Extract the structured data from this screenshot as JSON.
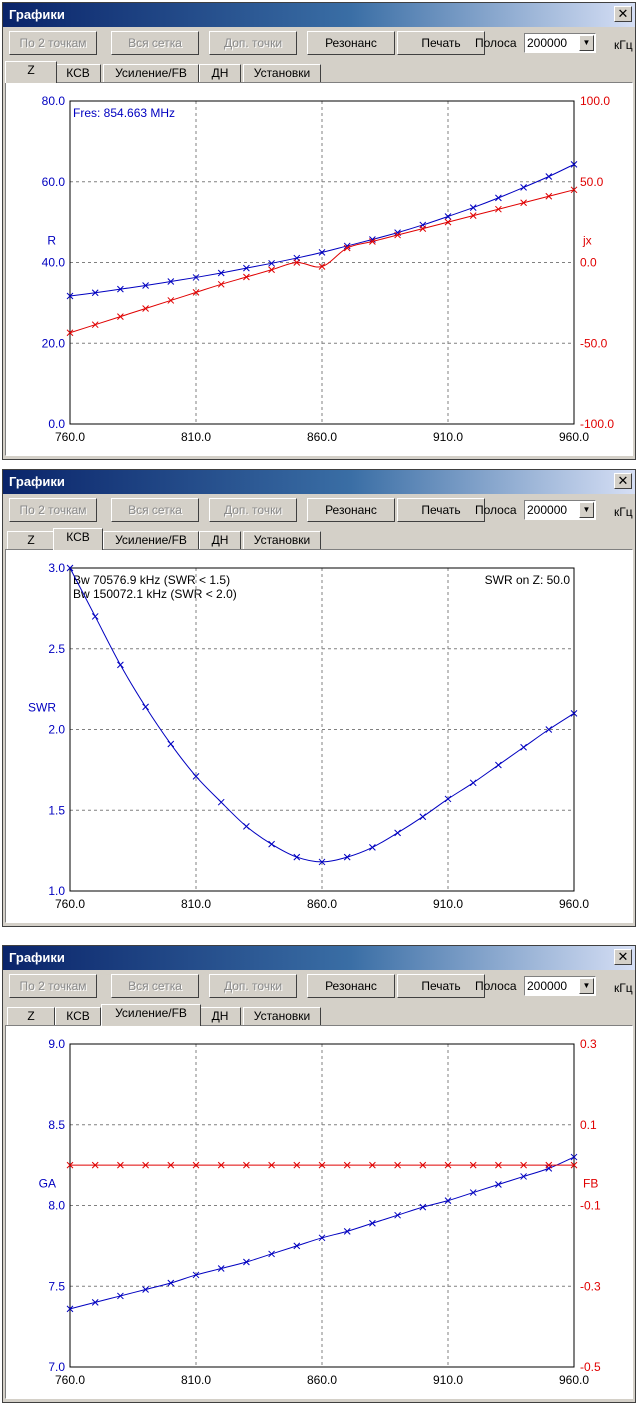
{
  "panels": [
    {
      "window_title": "Графики",
      "toolbar": {
        "btn_two_points": "По 2 точкам",
        "btn_all_grid": "Вся сетка",
        "btn_extra_points": "Доп. точки",
        "btn_resonance": "Резонанс",
        "btn_print": "Печать",
        "band_label": "Полоса",
        "band_value": "200000",
        "band_unit": "кГц"
      },
      "tabs": [
        "Z",
        "КСВ",
        "Усиление/FB",
        "ДН",
        "Установки"
      ],
      "active_tab": 0,
      "annotations": [
        {
          "text": "Fres: 854.663 MHz",
          "color": "#0000c0",
          "corner": "top-left",
          "line": 0
        }
      ],
      "chart_data": {
        "type": "line",
        "x": [
          760,
          770,
          780,
          790,
          800,
          810,
          820,
          830,
          840,
          850,
          860,
          870,
          880,
          890,
          900,
          910,
          920,
          930,
          940,
          950,
          960
        ],
        "xlim": [
          760,
          960
        ],
        "xticks": [
          "760.0",
          "810.0",
          "860.0",
          "910.0",
          "960.0"
        ],
        "left_axis": {
          "label": "R",
          "color": "#0000c0",
          "lim": [
            0,
            80
          ],
          "ticks": [
            "0.0",
            "20.0",
            "40.0",
            "60.0",
            "80.0"
          ]
        },
        "right_axis": {
          "label": "jx",
          "color": "#e00000",
          "lim": [
            -100,
            100
          ],
          "ticks": [
            "-100.0",
            "-50.0",
            "0.0",
            "50.0",
            "100.0"
          ]
        },
        "grid": true,
        "series": [
          {
            "axis": "left",
            "color": "#0000c0",
            "values": [
              31.7,
              32.5,
              33.4,
              34.3,
              35.3,
              36.3,
              37.4,
              38.6,
              39.8,
              41.1,
              42.5,
              44.1,
              45.7,
              47.4,
              49.3,
              51.4,
              53.6,
              56.0,
              58.6,
              61.3,
              64.3
            ]
          },
          {
            "axis": "right",
            "color": "#e00000",
            "values": [
              -43.5,
              -38.5,
              -33.5,
              -28.5,
              -23.5,
              -18.5,
              -13.5,
              -9,
              -4.5,
              0,
              -2.5,
              9,
              13,
              17,
              21,
              25,
              29,
              33,
              37,
              41,
              45
            ]
          }
        ]
      }
    },
    {
      "window_title": "Графики",
      "toolbar": {
        "btn_two_points": "По 2 точкам",
        "btn_all_grid": "Вся сетка",
        "btn_extra_points": "Доп. точки",
        "btn_resonance": "Резонанс",
        "btn_print": "Печать",
        "band_label": "Полоса",
        "band_value": "200000",
        "band_unit": "кГц"
      },
      "tabs": [
        "Z",
        "КСВ",
        "Усиление/FB",
        "ДН",
        "Установки"
      ],
      "active_tab": 1,
      "annotations": [
        {
          "text": "Bw 70576.9 kHz (SWR < 1.5)",
          "color": "#000000",
          "corner": "top-left",
          "line": 0
        },
        {
          "text": "Bw 150072.1 kHz (SWR < 2.0)",
          "color": "#000000",
          "corner": "top-left",
          "line": 1
        },
        {
          "text": "SWR on Z: 50.0",
          "color": "#000000",
          "corner": "top-right",
          "line": 0
        }
      ],
      "chart_data": {
        "type": "line",
        "x": [
          760,
          770,
          780,
          790,
          800,
          810,
          820,
          830,
          840,
          850,
          860,
          870,
          880,
          890,
          900,
          910,
          920,
          930,
          940,
          950,
          960
        ],
        "xlim": [
          760,
          960
        ],
        "xticks": [
          "760.0",
          "810.0",
          "860.0",
          "910.0",
          "960.0"
        ],
        "left_axis": {
          "label": "SWR",
          "color": "#0000c0",
          "lim": [
            1,
            3
          ],
          "ticks": [
            "1.0",
            "1.5",
            "2.0",
            "2.5",
            "3.0"
          ]
        },
        "grid": true,
        "series": [
          {
            "axis": "left",
            "color": "#0000c0",
            "values": [
              3.0,
              2.7,
              2.4,
              2.14,
              1.91,
              1.71,
              1.55,
              1.4,
              1.29,
              1.21,
              1.18,
              1.21,
              1.27,
              1.36,
              1.46,
              1.57,
              1.67,
              1.78,
              1.89,
              2.0,
              2.1
            ]
          }
        ]
      }
    },
    {
      "window_title": "Графики",
      "toolbar": {
        "btn_two_points": "По 2 точкам",
        "btn_all_grid": "Вся сетка",
        "btn_extra_points": "Доп. точки",
        "btn_resonance": "Резонанс",
        "btn_print": "Печать",
        "band_label": "Полоса",
        "band_value": "200000",
        "band_unit": "кГц"
      },
      "tabs": [
        "Z",
        "КСВ",
        "Усиление/FB",
        "ДН",
        "Установки"
      ],
      "active_tab": 2,
      "annotations": [],
      "chart_data": {
        "type": "line",
        "x": [
          760,
          770,
          780,
          790,
          800,
          810,
          820,
          830,
          840,
          850,
          860,
          870,
          880,
          890,
          900,
          910,
          920,
          930,
          940,
          950,
          960
        ],
        "xlim": [
          760,
          960
        ],
        "xticks": [
          "760.0",
          "810.0",
          "860.0",
          "910.0",
          "960.0"
        ],
        "left_axis": {
          "label": "GA",
          "color": "#0000c0",
          "lim": [
            7,
            9
          ],
          "ticks": [
            "7.0",
            "7.5",
            "8.0",
            "8.5",
            "9.0"
          ]
        },
        "right_axis": {
          "label": "FB",
          "color": "#e00000",
          "lim": [
            -0.5,
            0.3
          ],
          "ticks": [
            "-0.5",
            "-0.3",
            "-0.1",
            "0.1",
            "0.3"
          ]
        },
        "grid": true,
        "series": [
          {
            "axis": "left",
            "color": "#0000c0",
            "values": [
              7.36,
              7.4,
              7.44,
              7.48,
              7.52,
              7.57,
              7.61,
              7.65,
              7.7,
              7.75,
              7.8,
              7.84,
              7.89,
              7.94,
              7.99,
              8.03,
              8.08,
              8.13,
              8.18,
              8.23,
              8.3
            ]
          },
          {
            "axis": "right",
            "color": "#e00000",
            "values": [
              0.0,
              0.0,
              0.0,
              0.0,
              0.0,
              0.0,
              0.0,
              0.0,
              0.0,
              0.0,
              0.0,
              0.0,
              0.0,
              0.0,
              0.0,
              0.0,
              0.0,
              0.0,
              0.0,
              0.0,
              0.0
            ]
          }
        ]
      }
    }
  ]
}
